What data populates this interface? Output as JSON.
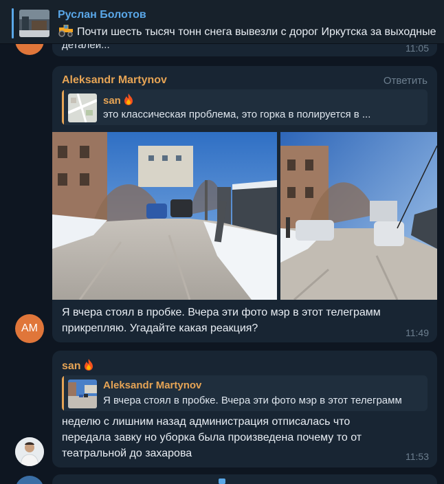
{
  "pinned": {
    "name": "Руслан Болотов",
    "text": "Почти шесть тысяч тонн снега вывезли с дорог Иркутска за выходные",
    "thumb_icon": "news-photo-thumbnail",
    "emoji_icon": "tractor-icon"
  },
  "top_message": {
    "partial_text": "деталей...",
    "time": "11:05"
  },
  "message1": {
    "author": "Aleksandr Martynov",
    "reply_label": "Ответить",
    "quote": {
      "name": "san",
      "text": "это классическая проблема, это горка в полируется в ..."
    },
    "text_line1": "Я вчера стоял в пробке. Вчера эти фото мэр в этот телеграмм",
    "text_line2": "прикрепляю. Угадайте какая реакция?",
    "time": "11:49",
    "avatar_initials": "AM"
  },
  "message2": {
    "author": "san",
    "quote": {
      "name": "Aleksandr Martynov",
      "text": "Я вчера стоял в пробке. Вчера эти фото мэр в этот телеграмм"
    },
    "text_line1": "неделю с лишним назад администрация отписалась что",
    "text_line2": "передала завку но уборка была произведена почему то от",
    "text_line3": "театральной до захарова",
    "time": "11:53"
  },
  "colors": {
    "background": "#0e1621",
    "bubble": "#182533",
    "author_accent": "#e6a455",
    "pinned_accent": "#5aa7e8",
    "avatar_am": "#e0763a"
  }
}
